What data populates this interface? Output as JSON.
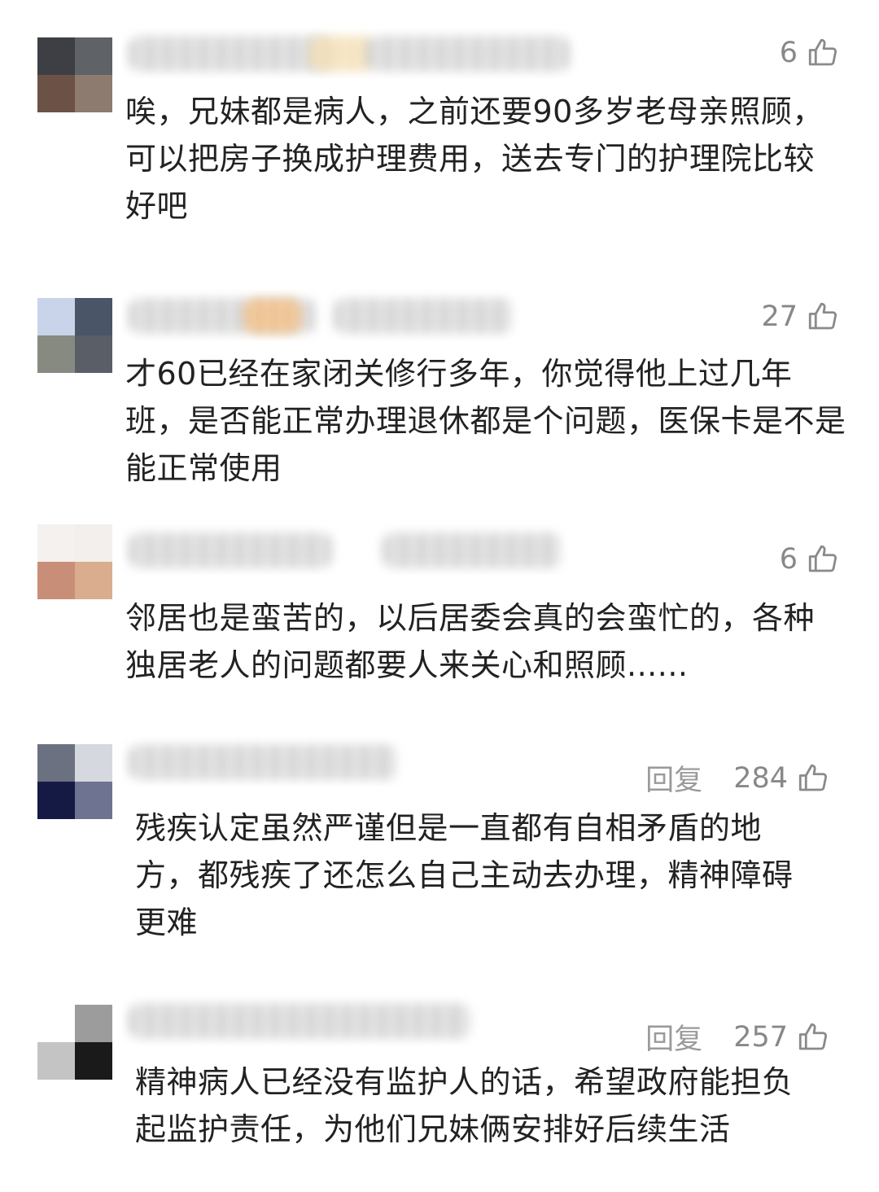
{
  "comments": [
    {
      "likes": "6",
      "reply_label": "",
      "text": "唉，兄妹都是病人，之前还要90多岁老母亲照顾，可以把房子换成护理费用，送去专门的护理院比较好吧",
      "avatar_colors": [
        "#3d3f45",
        "#5f6266",
        "#6c5246",
        "#8e7b70"
      ]
    },
    {
      "likes": "27",
      "reply_label": "",
      "text": "才60已经在家闭关修行多年，你觉得他上过几年班，是否能正常办理退休都是个问题，医保卡是不是能正常使用",
      "avatar_colors": [
        "#c9d3ea",
        "#4a5668",
        "#878a80",
        "#5a5e66"
      ]
    },
    {
      "likes": "6",
      "reply_label": "",
      "text": "邻居也是蛮苦的，以后居委会真的会蛮忙的，各种独居老人的问题都要人来关心和照顾......",
      "avatar_colors": [
        "#f4f1ee",
        "#f2efec",
        "#c98e78",
        "#d9ad8e"
      ]
    },
    {
      "likes": "284",
      "reply_label": "回复",
      "text": "残疾认定虽然严谨但是一直都有自相矛盾的地方，都残疾了还怎么自己主动去办理，精神障碍更难",
      "avatar_colors": [
        "#6b7180",
        "#d6d8e0",
        "#151a45",
        "#6d7390"
      ]
    },
    {
      "likes": "257",
      "reply_label": "回复",
      "text": "精神病人已经没有监护人的话，希望政府能担负起监护责任，为他们兄妹俩安排好后续生活",
      "avatar_colors": [
        "#ffffff",
        "#9c9c9c",
        "#c4c4c4",
        "#1a1a1a"
      ]
    }
  ]
}
